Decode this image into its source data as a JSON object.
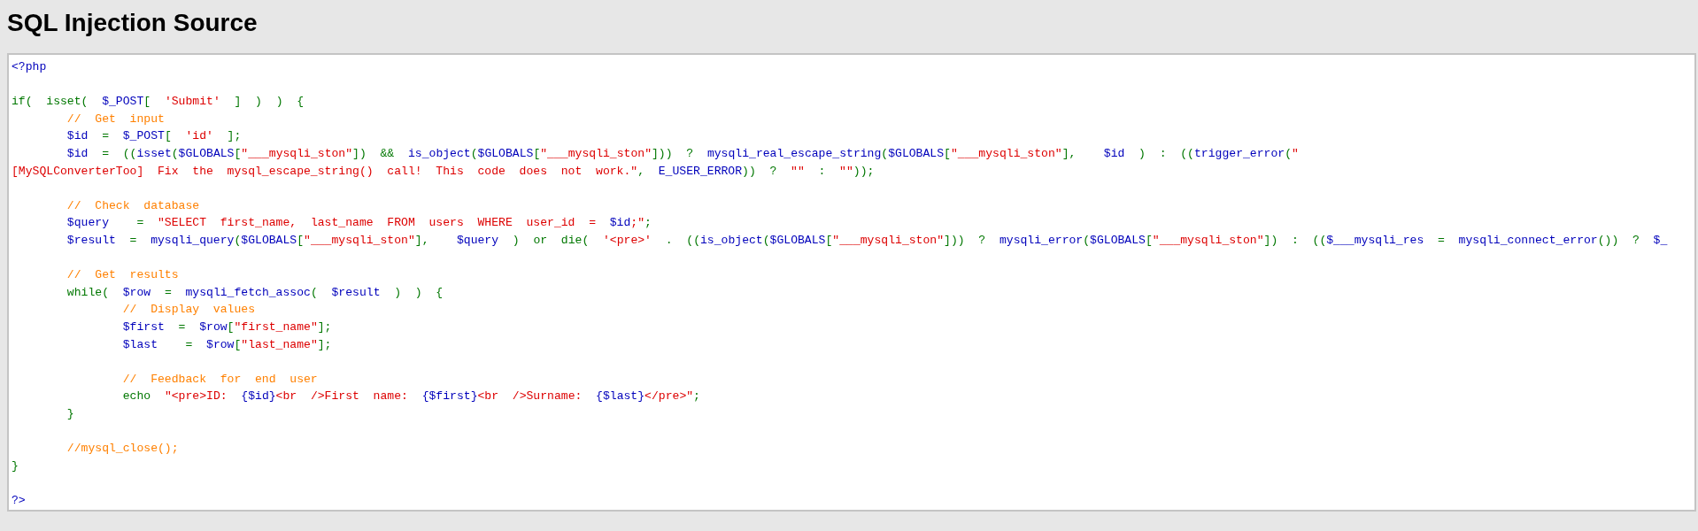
{
  "title": "SQL Injection Source",
  "code_lines": [
    {
      "gap_before": false,
      "tokens": [
        {
          "text": "<?php",
          "kind": "default"
        }
      ]
    },
    {
      "gap_before": true,
      "tokens": [
        {
          "text": "if(  isset(  ",
          "kind": "keyword"
        },
        {
          "text": "$_POST",
          "kind": "default"
        },
        {
          "text": "[  ",
          "kind": "keyword"
        },
        {
          "text": "'Submit'",
          "kind": "string"
        },
        {
          "text": "  ]  )  )  {",
          "kind": "keyword"
        }
      ]
    },
    {
      "gap_before": false,
      "tokens": [
        {
          "text": "        //  Get  input",
          "kind": "comment"
        }
      ]
    },
    {
      "gap_before": false,
      "tokens": [
        {
          "text": "        $id  ",
          "kind": "default"
        },
        {
          "text": "=  ",
          "kind": "keyword"
        },
        {
          "text": "$_POST",
          "kind": "default"
        },
        {
          "text": "[  ",
          "kind": "keyword"
        },
        {
          "text": "'id'",
          "kind": "string"
        },
        {
          "text": "  ];",
          "kind": "keyword"
        }
      ]
    },
    {
      "gap_before": false,
      "tokens": [
        {
          "text": "        $id  ",
          "kind": "default"
        },
        {
          "text": "=  ((",
          "kind": "keyword"
        },
        {
          "text": "isset",
          "kind": "default"
        },
        {
          "text": "(",
          "kind": "keyword"
        },
        {
          "text": "$GLOBALS",
          "kind": "default"
        },
        {
          "text": "[",
          "kind": "keyword"
        },
        {
          "text": "\"___mysqli_ston\"",
          "kind": "string"
        },
        {
          "text": "])  &&  ",
          "kind": "keyword"
        },
        {
          "text": "is_object",
          "kind": "default"
        },
        {
          "text": "(",
          "kind": "keyword"
        },
        {
          "text": "$GLOBALS",
          "kind": "default"
        },
        {
          "text": "[",
          "kind": "keyword"
        },
        {
          "text": "\"___mysqli_ston\"",
          "kind": "string"
        },
        {
          "text": "]))  ?  ",
          "kind": "keyword"
        },
        {
          "text": "mysqli_real_escape_string",
          "kind": "default"
        },
        {
          "text": "(",
          "kind": "keyword"
        },
        {
          "text": "$GLOBALS",
          "kind": "default"
        },
        {
          "text": "[",
          "kind": "keyword"
        },
        {
          "text": "\"___mysqli_ston\"",
          "kind": "string"
        },
        {
          "text": "],    ",
          "kind": "keyword"
        },
        {
          "text": "$id  ",
          "kind": "default"
        },
        {
          "text": ")  :  ((",
          "kind": "keyword"
        },
        {
          "text": "trigger_error",
          "kind": "default"
        },
        {
          "text": "(",
          "kind": "keyword"
        },
        {
          "text": "\"",
          "kind": "string"
        }
      ]
    },
    {
      "gap_before": false,
      "tokens": [
        {
          "text": "[MySQLConverterToo]  Fix  the  mysql_escape_string()  call!  This  code  does  not  work.\"",
          "kind": "string"
        },
        {
          "text": ",  ",
          "kind": "keyword"
        },
        {
          "text": "E_USER_ERROR",
          "kind": "default"
        },
        {
          "text": "))  ?  ",
          "kind": "keyword"
        },
        {
          "text": "\"\"",
          "kind": "string"
        },
        {
          "text": "  :  ",
          "kind": "keyword"
        },
        {
          "text": "\"\"",
          "kind": "string"
        },
        {
          "text": "));",
          "kind": "keyword"
        }
      ]
    },
    {
      "gap_before": true,
      "tokens": [
        {
          "text": "        //  Check  database",
          "kind": "comment"
        }
      ]
    },
    {
      "gap_before": false,
      "tokens": [
        {
          "text": "        $query    ",
          "kind": "default"
        },
        {
          "text": "=  ",
          "kind": "keyword"
        },
        {
          "text": "\"SELECT  first_name,  last_name  FROM  users  WHERE  user_id  =  ",
          "kind": "string"
        },
        {
          "text": "$id",
          "kind": "default"
        },
        {
          "text": ";\"",
          "kind": "string"
        },
        {
          "text": ";",
          "kind": "keyword"
        }
      ]
    },
    {
      "gap_before": false,
      "tokens": [
        {
          "text": "        $result  ",
          "kind": "default"
        },
        {
          "text": "=  ",
          "kind": "keyword"
        },
        {
          "text": "mysqli_query",
          "kind": "default"
        },
        {
          "text": "(",
          "kind": "keyword"
        },
        {
          "text": "$GLOBALS",
          "kind": "default"
        },
        {
          "text": "[",
          "kind": "keyword"
        },
        {
          "text": "\"___mysqli_ston\"",
          "kind": "string"
        },
        {
          "text": "],    ",
          "kind": "keyword"
        },
        {
          "text": "$query  ",
          "kind": "default"
        },
        {
          "text": ")  or  die(  ",
          "kind": "keyword"
        },
        {
          "text": "'<pre>'",
          "kind": "string"
        },
        {
          "text": "  .  ((",
          "kind": "keyword"
        },
        {
          "text": "is_object",
          "kind": "default"
        },
        {
          "text": "(",
          "kind": "keyword"
        },
        {
          "text": "$GLOBALS",
          "kind": "default"
        },
        {
          "text": "[",
          "kind": "keyword"
        },
        {
          "text": "\"___mysqli_ston\"",
          "kind": "string"
        },
        {
          "text": "]))  ?  ",
          "kind": "keyword"
        },
        {
          "text": "mysqli_error",
          "kind": "default"
        },
        {
          "text": "(",
          "kind": "keyword"
        },
        {
          "text": "$GLOBALS",
          "kind": "default"
        },
        {
          "text": "[",
          "kind": "keyword"
        },
        {
          "text": "\"___mysqli_ston\"",
          "kind": "string"
        },
        {
          "text": "])  :  ((",
          "kind": "keyword"
        },
        {
          "text": "$___mysqli_res  ",
          "kind": "default"
        },
        {
          "text": "=  ",
          "kind": "keyword"
        },
        {
          "text": "mysqli_connect_error",
          "kind": "default"
        },
        {
          "text": "())  ?  ",
          "kind": "keyword"
        },
        {
          "text": "$_",
          "kind": "default"
        }
      ]
    },
    {
      "gap_before": true,
      "tokens": [
        {
          "text": "        //  Get  results",
          "kind": "comment"
        }
      ]
    },
    {
      "gap_before": false,
      "tokens": [
        {
          "text": "        while(  ",
          "kind": "keyword"
        },
        {
          "text": "$row  ",
          "kind": "default"
        },
        {
          "text": "=  ",
          "kind": "keyword"
        },
        {
          "text": "mysqli_fetch_assoc",
          "kind": "default"
        },
        {
          "text": "(  ",
          "kind": "keyword"
        },
        {
          "text": "$result  ",
          "kind": "default"
        },
        {
          "text": ")  )  {",
          "kind": "keyword"
        }
      ]
    },
    {
      "gap_before": false,
      "tokens": [
        {
          "text": "                //  Display  values",
          "kind": "comment"
        }
      ]
    },
    {
      "gap_before": false,
      "tokens": [
        {
          "text": "                $first  ",
          "kind": "default"
        },
        {
          "text": "=  ",
          "kind": "keyword"
        },
        {
          "text": "$row",
          "kind": "default"
        },
        {
          "text": "[",
          "kind": "keyword"
        },
        {
          "text": "\"first_name\"",
          "kind": "string"
        },
        {
          "text": "];",
          "kind": "keyword"
        }
      ]
    },
    {
      "gap_before": false,
      "tokens": [
        {
          "text": "                $last    ",
          "kind": "default"
        },
        {
          "text": "=  ",
          "kind": "keyword"
        },
        {
          "text": "$row",
          "kind": "default"
        },
        {
          "text": "[",
          "kind": "keyword"
        },
        {
          "text": "\"last_name\"",
          "kind": "string"
        },
        {
          "text": "];",
          "kind": "keyword"
        }
      ]
    },
    {
      "gap_before": true,
      "tokens": [
        {
          "text": "                //  Feedback  for  end  user",
          "kind": "comment"
        }
      ]
    },
    {
      "gap_before": false,
      "tokens": [
        {
          "text": "                echo  ",
          "kind": "keyword"
        },
        {
          "text": "\"<pre>ID:  ",
          "kind": "string"
        },
        {
          "text": "{$id}",
          "kind": "default"
        },
        {
          "text": "<br  />First  name:  ",
          "kind": "string"
        },
        {
          "text": "{$first}",
          "kind": "default"
        },
        {
          "text": "<br  />Surname:  ",
          "kind": "string"
        },
        {
          "text": "{$last}",
          "kind": "default"
        },
        {
          "text": "</pre>\"",
          "kind": "string"
        },
        {
          "text": ";",
          "kind": "keyword"
        }
      ]
    },
    {
      "gap_before": false,
      "tokens": [
        {
          "text": "        }",
          "kind": "keyword"
        }
      ]
    },
    {
      "gap_before": true,
      "tokens": [
        {
          "text": "        //mysql_close();",
          "kind": "comment"
        }
      ]
    },
    {
      "gap_before": false,
      "tokens": [
        {
          "text": "}",
          "kind": "keyword"
        }
      ]
    },
    {
      "gap_before": true,
      "tokens": [
        {
          "text": "?>",
          "kind": "default"
        }
      ]
    }
  ]
}
